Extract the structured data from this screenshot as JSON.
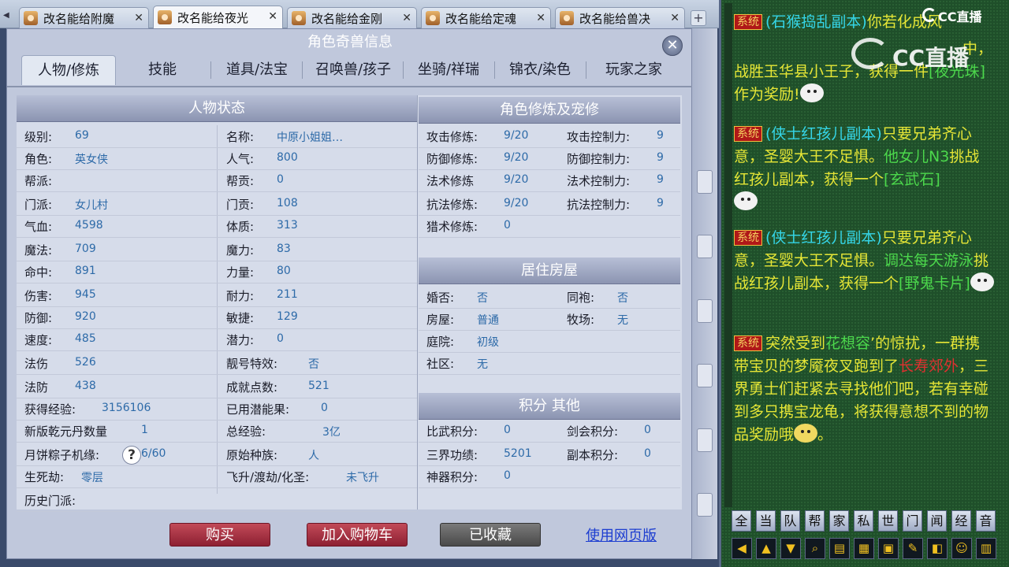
{
  "browser": {
    "tabs": [
      {
        "label": "改名能给附魔",
        "active": false
      },
      {
        "label": "改名能给夜光",
        "active": true
      },
      {
        "label": "改名能给金刚",
        "active": false
      },
      {
        "label": "改名能给定魂",
        "active": false
      },
      {
        "label": "改名能给兽决",
        "active": false
      }
    ],
    "close_glyph": "✕",
    "add_glyph": "+",
    "scroll_glyph": "◀"
  },
  "panel": {
    "title": "角色奇兽信息",
    "close_glyph": "✕",
    "nav_tabs": [
      "人物/修炼",
      "技能",
      "道具/法宝",
      "召唤兽/孩子",
      "坐骑/祥瑞",
      "锦衣/染色",
      "玩家之家"
    ],
    "active_tab": "人物/修炼"
  },
  "status": {
    "header": "人物状态",
    "left": [
      {
        "label": "级别:",
        "value": "69"
      },
      {
        "label": "角色:",
        "value": "英女侠"
      },
      {
        "label": "帮派:",
        "value": ""
      },
      {
        "label": "门派:",
        "value": "女儿村"
      },
      {
        "label": "气血:",
        "value": "4598"
      },
      {
        "label": "魔法:",
        "value": "709"
      },
      {
        "label": "命中:",
        "value": "891"
      },
      {
        "label": "伤害:",
        "value": "945"
      },
      {
        "label": "防御:",
        "value": "920"
      },
      {
        "label": "速度:",
        "value": "485"
      },
      {
        "label": "法伤",
        "value": "526"
      },
      {
        "label": "法防",
        "value": "438"
      },
      {
        "label": "获得经验:",
        "value": "3156106"
      },
      {
        "label": "新版乾元丹数量",
        "value": "1"
      },
      {
        "label": "月饼粽子机缘:",
        "value": "6/60"
      },
      {
        "label": "生死劫:",
        "value": "零层"
      },
      {
        "label": "历史门派:",
        "value": ""
      }
    ],
    "right": [
      {
        "label": "名称:",
        "value": "中原小姐姐…"
      },
      {
        "label": "人气:",
        "value": "800"
      },
      {
        "label": "帮贡:",
        "value": "0"
      },
      {
        "label": "门贡:",
        "value": "108"
      },
      {
        "label": "体质:",
        "value": "313"
      },
      {
        "label": "魔力:",
        "value": "83"
      },
      {
        "label": "力量:",
        "value": "80"
      },
      {
        "label": "耐力:",
        "value": "211"
      },
      {
        "label": "敏捷:",
        "value": "129"
      },
      {
        "label": "潜力:",
        "value": "0"
      },
      {
        "label": "靓号特效:",
        "value": "否"
      },
      {
        "label": "成就点数:",
        "value": "521"
      },
      {
        "label": "已用潜能果:",
        "value": "0"
      },
      {
        "label": "总经验:",
        "value": "3亿"
      },
      {
        "label": "原始种族:",
        "value": "人"
      },
      {
        "label": "飞升/渡劫/化圣:",
        "value": "未飞升"
      }
    ],
    "help_glyph": "?"
  },
  "cultivation": {
    "header": "角色修炼及宠修",
    "left": [
      {
        "label": "攻击修炼:",
        "value": "9/20"
      },
      {
        "label": "防御修炼:",
        "value": "9/20"
      },
      {
        "label": "法术修炼",
        "value": "9/20"
      },
      {
        "label": "抗法修炼:",
        "value": "9/20"
      },
      {
        "label": "猎术修炼:",
        "value": "0"
      }
    ],
    "right": [
      {
        "label": "攻击控制力:",
        "value": "9"
      },
      {
        "label": "防御控制力:",
        "value": "9"
      },
      {
        "label": "法术控制力:",
        "value": "9"
      },
      {
        "label": "抗法控制力:",
        "value": "9"
      }
    ]
  },
  "housing": {
    "header": "居住房屋",
    "left": [
      {
        "label": "婚否:",
        "value": "否"
      },
      {
        "label": "房屋:",
        "value": "普通"
      },
      {
        "label": "庭院:",
        "value": "初级"
      },
      {
        "label": "社区:",
        "value": "无"
      }
    ],
    "right": [
      {
        "label": "同袍:",
        "value": "否"
      },
      {
        "label": "牧场:",
        "value": "无"
      }
    ]
  },
  "points": {
    "header": "积分 其他",
    "left": [
      {
        "label": "比武积分:",
        "value": "0"
      },
      {
        "label": "三界功绩:",
        "value": "5201"
      },
      {
        "label": "神器积分:",
        "value": "0"
      }
    ],
    "right": [
      {
        "label": "剑会积分:",
        "value": "0"
      },
      {
        "label": "副本积分:",
        "value": "0"
      }
    ]
  },
  "actions": {
    "buy": "购买",
    "add_cart": "加入购物车",
    "favorited": "已收藏",
    "web_version": "使用网页版"
  },
  "chat": {
    "messages": [
      {
        "tag": "系统",
        "p1": "(石猴捣乱副本)",
        "p2": "你若化成风"
      },
      {
        "p1": "中",
        "p2": "，战胜玉华县小王子，获得一件",
        "p3": "[夜光",
        "p4": "珠]",
        "p5": "作为奖励!"
      },
      {
        "tag": "系统",
        "p1": "(侠士红孩儿副本)",
        "p2": "只要兄弟齐心意，圣婴大王不足惧。",
        "p3": "他女儿N3",
        "p4": "挑战红孩儿副本，获得一个",
        "p5": "[玄武石]"
      },
      {
        "tag": "系统",
        "p1": "(侠士红孩儿副本)",
        "p2": "只要兄弟齐心意，圣婴大王不足惧。",
        "p3": "调达每天游泳",
        "p4": "挑战红孩儿副本，获得一个",
        "p5": "[野鬼卡片]"
      },
      {
        "tag": "系统",
        "p1": "突然受到",
        "p2": "花想容",
        "p3": "’的惊扰，一群携带宝贝的梦魇夜叉跑到了",
        "p4": "长寿郊外",
        "p5": "，三界勇士们赶紧去寻找他们吧，若有幸碰到多只携宝龙龟，将获得意想不到的物品奖励哦",
        "p6": "。"
      }
    ],
    "channel_keys": [
      "全",
      "当",
      "队",
      "帮",
      "家",
      "私",
      "世",
      "门",
      "闻",
      "经",
      "音"
    ],
    "tool_keys": [
      "◀",
      "▲",
      "▼",
      "⌕",
      "▤",
      "▦",
      "▣",
      "✎",
      "◧",
      "☺",
      "▥"
    ],
    "watermark": "CC直播",
    "logo": "CC直播"
  }
}
